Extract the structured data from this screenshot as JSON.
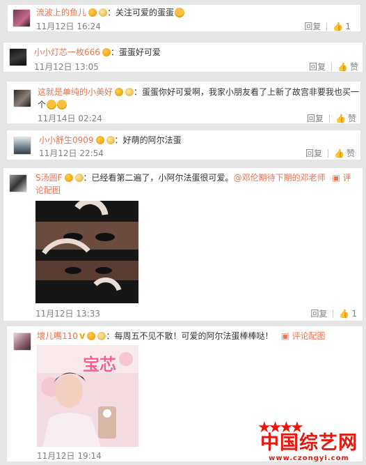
{
  "comments": [
    {
      "username": "流波上的鱼儿",
      "text": "关注可爱的蛋蛋",
      "time": "11月12日 16:24",
      "reply_label": "回复",
      "like_label": "1"
    },
    {
      "username": "小小灯芯一枚666",
      "text": "蛋蛋好可爱",
      "time": "11月12日 13:05",
      "reply_label": "回复",
      "like_label": "赞"
    },
    {
      "username": "这就是单纯的小美好",
      "text": "蛋蛋你好可爱啊，我家小朋友看了上新了故宫非要我也买一",
      "text_cont": "个",
      "time": "11月14日 02:24",
      "reply_label": "回复",
      "like_label": "赞"
    },
    {
      "username": "小小舒生0909",
      "text": "好萌的阿尔法蛋",
      "time": "11月12日 22:54",
      "reply_label": "回复",
      "like_label": "赞"
    },
    {
      "username": "S汤圆F",
      "text": "已经看第二遍了，小阿尔法蛋很可爱。",
      "mention": "@邓伦期待下期的邓老师",
      "comment_pic_label": "评",
      "comment_pic_label_cont": "论配图",
      "time": "11月12日 13:33",
      "reply_label": "回复",
      "like_label": "1"
    },
    {
      "username": "壞儿嗎110",
      "text": "每周五不见不散！可爱的阿尔法蛋棒棒哒！",
      "comment_pic_label": "评论配图",
      "time": "11月12日 19:14",
      "photo_caption": "宝芯"
    }
  ],
  "colon": "：",
  "watermark": {
    "title": "中国综艺网",
    "url": "www.czongyi.com"
  },
  "colors": {
    "username": "#eb7350",
    "timestamp": "#808080",
    "background": "#e6e6e6",
    "watermark": "#e8170d"
  }
}
